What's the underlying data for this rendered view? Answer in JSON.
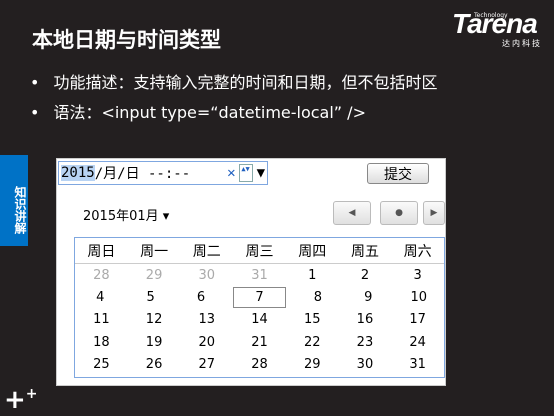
{
  "title": "本地日期与时间类型",
  "logo": {
    "main": "Tarena",
    "sub": "Technology",
    "cn": "达内科技"
  },
  "bullets": [
    "功能描述：支持输入完整的时间和日期，但不包括时区",
    "语法：<input type=“datetime-local” />"
  ],
  "side_tab": "知识讲解",
  "input": {
    "year": "2015",
    "rest": "/月/日 --:--",
    "clear": "✕",
    "spin": "▲▼",
    "dropdown": "▼"
  },
  "submit": "提交",
  "calendar": {
    "month_label": "2015年01月 ▾",
    "nav": {
      "prev": "◀",
      "today": "●",
      "next": "▶"
    },
    "weekdays": [
      "周日",
      "周一",
      "周二",
      "周三",
      "周四",
      "周五",
      "周六"
    ],
    "weeks": [
      [
        "28",
        "29",
        "30",
        "31",
        "1",
        "2",
        "3"
      ],
      [
        "4",
        "5",
        "6",
        "7",
        "8",
        "9",
        "10"
      ],
      [
        "11",
        "12",
        "13",
        "14",
        "15",
        "16",
        "17"
      ],
      [
        "18",
        "19",
        "20",
        "21",
        "22",
        "23",
        "24"
      ],
      [
        "25",
        "26",
        "27",
        "28",
        "29",
        "30",
        "31"
      ]
    ],
    "today": "7"
  }
}
